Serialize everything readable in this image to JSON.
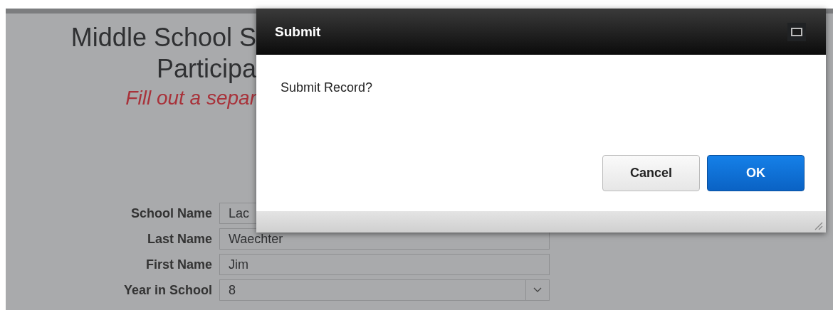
{
  "page": {
    "title_lines": [
      "Middle School S",
      "Participa"
    ],
    "subtitle": "Fill out a separ"
  },
  "form": {
    "fields": [
      {
        "label": "School Name",
        "value": "Lac",
        "kind": "text"
      },
      {
        "label": "Last Name",
        "value": "Waechter",
        "kind": "text"
      },
      {
        "label": "First Name",
        "value": "Jim",
        "kind": "text"
      },
      {
        "label": "Year in School",
        "value": "8",
        "kind": "select"
      }
    ]
  },
  "dialog": {
    "title": "Submit",
    "message": "Submit Record?",
    "buttons": [
      {
        "label": "Cancel",
        "kind": "secondary"
      },
      {
        "label": "OK",
        "kind": "primary"
      }
    ]
  }
}
